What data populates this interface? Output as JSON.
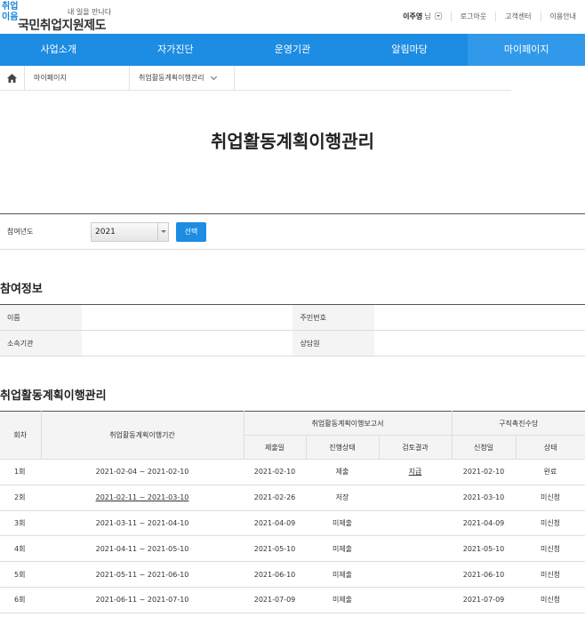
{
  "header": {
    "logo_mark": "취업이음",
    "slogan": "내 일을 만나다",
    "site_title": "국민취업지원제도",
    "user_name": "이주영",
    "user_suffix": "님",
    "links": [
      "로그아웃",
      "고객센터",
      "이용안내"
    ]
  },
  "gnb": [
    "사업소개",
    "자가진단",
    "운영기관",
    "알림마당",
    "마이페이지"
  ],
  "breadcrumb": {
    "home_icon": "home-icon",
    "level1": "마이페이지",
    "level2": "취업활동계획이행관리"
  },
  "page_title": "취업활동계획이행관리",
  "year_select": {
    "label": "참여년도",
    "value": "2021",
    "button": "선택"
  },
  "participation": {
    "title": "참여정보",
    "labels": {
      "name": "이름",
      "id_number": "주민번호",
      "agency": "소속기관",
      "counselor": "상담원"
    }
  },
  "plan": {
    "title": "취업활동계획이행관리",
    "headers": {
      "round": "회차",
      "period": "취업활동계획이행기간",
      "report": "취업활동계획이행보고서",
      "report_date": "제출일",
      "progress": "진행상태",
      "review": "검토결과",
      "allowance": "구직촉진수당",
      "apply_date": "신청일",
      "status": "상태"
    },
    "rows": [
      {
        "round": "1회",
        "period": "2021-02-04 ~ 2021-02-10",
        "report_date": "2021-02-10",
        "progress": "제출",
        "review": "지급",
        "apply_date": "2021-02-10",
        "status": "완료"
      },
      {
        "round": "2회",
        "period": "2021-02-11 ~ 2021-03-10",
        "report_date": "2021-02-26",
        "progress": "저장",
        "review": "",
        "apply_date": "2021-03-10",
        "status": "미신청"
      },
      {
        "round": "3회",
        "period": "2021-03-11 ~ 2021-04-10",
        "report_date": "2021-04-09",
        "progress": "미제출",
        "review": "",
        "apply_date": "2021-04-09",
        "status": "미신청"
      },
      {
        "round": "4회",
        "period": "2021-04-11 ~ 2021-05-10",
        "report_date": "2021-05-10",
        "progress": "미제출",
        "review": "",
        "apply_date": "2021-05-10",
        "status": "미신청"
      },
      {
        "round": "5회",
        "period": "2021-05-11 ~ 2021-06-10",
        "report_date": "2021-06-10",
        "progress": "미제출",
        "review": "",
        "apply_date": "2021-06-10",
        "status": "미신청"
      },
      {
        "round": "6회",
        "period": "2021-06-11 ~ 2021-07-10",
        "report_date": "2021-07-09",
        "progress": "미제출",
        "review": "",
        "apply_date": "2021-07-09",
        "status": "미신청"
      }
    ]
  },
  "colors": {
    "accent": "#1d8ce3",
    "active_menu": "#3199ea"
  }
}
